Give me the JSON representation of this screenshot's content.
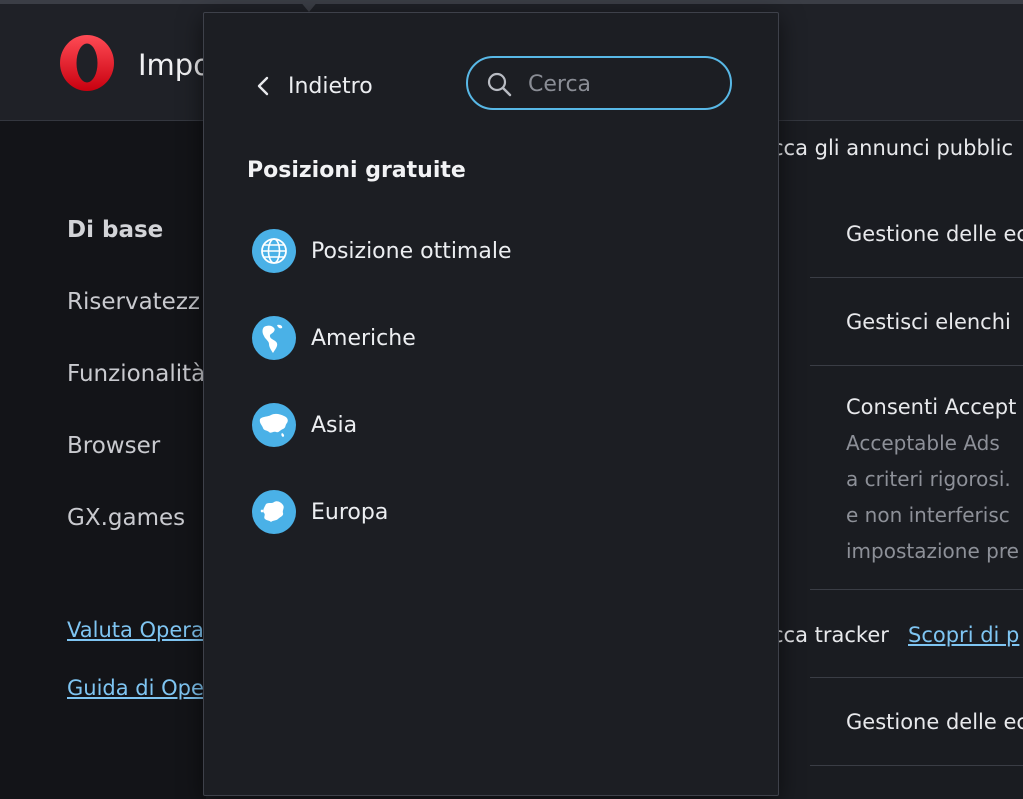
{
  "header": {
    "title": "Impo"
  },
  "sidebar": {
    "items": [
      {
        "label": "Di base"
      },
      {
        "label": "Riservatezz"
      },
      {
        "label": "Funzionalità"
      },
      {
        "label": "Browser"
      },
      {
        "label": "GX.games"
      }
    ],
    "links": [
      {
        "label": "Valuta Opera"
      },
      {
        "label": "Guida di Ope"
      }
    ]
  },
  "content": {
    "block_ads": "cca gli annunci pubblic",
    "manage_exceptions_1": "Gestione delle ec",
    "manage_lists": "Gestisci elenchi",
    "acceptable_ads_title": "Consenti Accept",
    "acceptable_ads_desc": [
      "Acceptable Ads",
      "a criteri rigorosi.",
      "e non interferisc",
      "impostazione pre"
    ],
    "block_trackers": "cca tracker",
    "learn_more": "Scopri di p",
    "manage_exceptions_2": "Gestione delle ec"
  },
  "popup": {
    "back_label": "Indietro",
    "search_placeholder": "Cerca",
    "search_value": "",
    "section_title": "Posizioni gratuite",
    "locations": [
      {
        "label": "Posizione ottimale",
        "icon": "globe-icon"
      },
      {
        "label": "Americhe",
        "icon": "americas-icon"
      },
      {
        "label": "Asia",
        "icon": "asia-icon"
      },
      {
        "label": "Europa",
        "icon": "europe-icon"
      }
    ]
  },
  "colors": {
    "accent": "#4ab1e7",
    "search_border": "#58b8e6",
    "link": "#7fc5f2",
    "brand": "#ff1b2d"
  }
}
